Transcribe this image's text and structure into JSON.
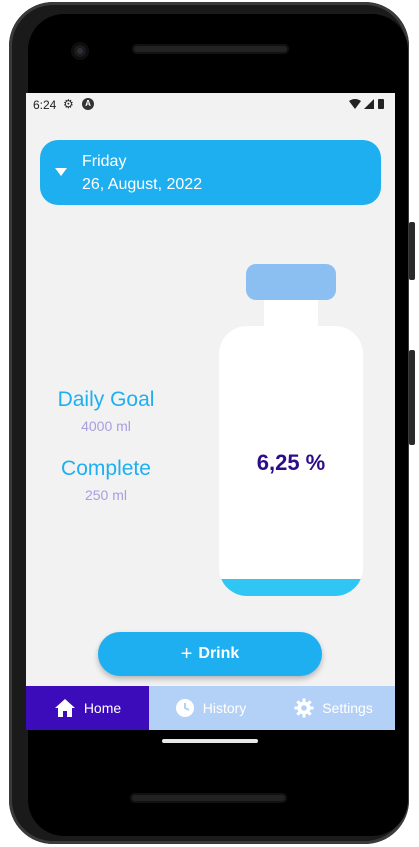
{
  "status_bar": {
    "time": "6:24"
  },
  "date_card": {
    "day": "Friday",
    "date": "26, August, 2022"
  },
  "stats": {
    "daily_goal_label": "Daily Goal",
    "daily_goal_value": "4000 ml",
    "complete_label": "Complete",
    "complete_value": "250 ml"
  },
  "bottle": {
    "percent_text": "6,25 %",
    "fill_fraction": 0.0625
  },
  "drink_button": {
    "label": "Drink"
  },
  "bottom_nav": {
    "items": [
      {
        "label": "Home",
        "icon": "home-icon",
        "active": true
      },
      {
        "label": "History",
        "icon": "clock-icon",
        "active": false
      },
      {
        "label": "Settings",
        "icon": "gear-icon",
        "active": false
      }
    ]
  },
  "colors": {
    "primary": "#1eaff0",
    "nav_active": "#3c0bba",
    "nav_inactive": "#b3d1f7",
    "percent_text": "#2d0d8a",
    "bottle_cap": "#8bbff1",
    "water": "#30c6f3"
  }
}
